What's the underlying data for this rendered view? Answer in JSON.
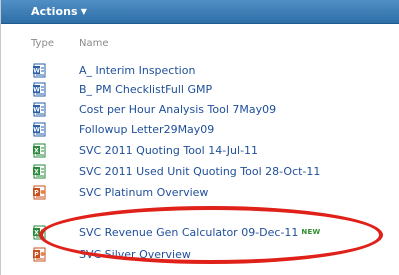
{
  "toolbar": {
    "actions_label": "Actions"
  },
  "columns": {
    "type": "Type",
    "name": "Name"
  },
  "rows": [
    {
      "icon": "word-document-icon",
      "name": "A_ Interim Inspection"
    },
    {
      "icon": "word-document-icon",
      "name": "B_ PM ChecklistFull GMP"
    },
    {
      "icon": "word-document-icon",
      "name": "Cost per Hour Analysis Tool 7May09"
    },
    {
      "icon": "word-document-icon",
      "name": "Followup Letter29May09"
    },
    {
      "icon": "excel-spreadsheet-icon",
      "name": "SVC 2011 Quoting Tool 14-Jul-11"
    },
    {
      "icon": "excel-spreadsheet-icon",
      "name": "SVC 2011 Used Unit Quoting Tool 28-Oct-11"
    },
    {
      "icon": "powerpoint-presentation-icon",
      "name": "SVC Platinum Overview"
    },
    {
      "icon": "excel-spreadsheet-icon",
      "name": "SVC Revenue Gen Calculator 09-Dec-11",
      "badge": "NEW"
    },
    {
      "icon": "powerpoint-presentation-icon",
      "name": "SVC Silver Overview"
    }
  ],
  "colors": {
    "toolbar": "#2f6fa8",
    "link": "#1f4f9a",
    "highlight_ring": "#e0211a"
  }
}
